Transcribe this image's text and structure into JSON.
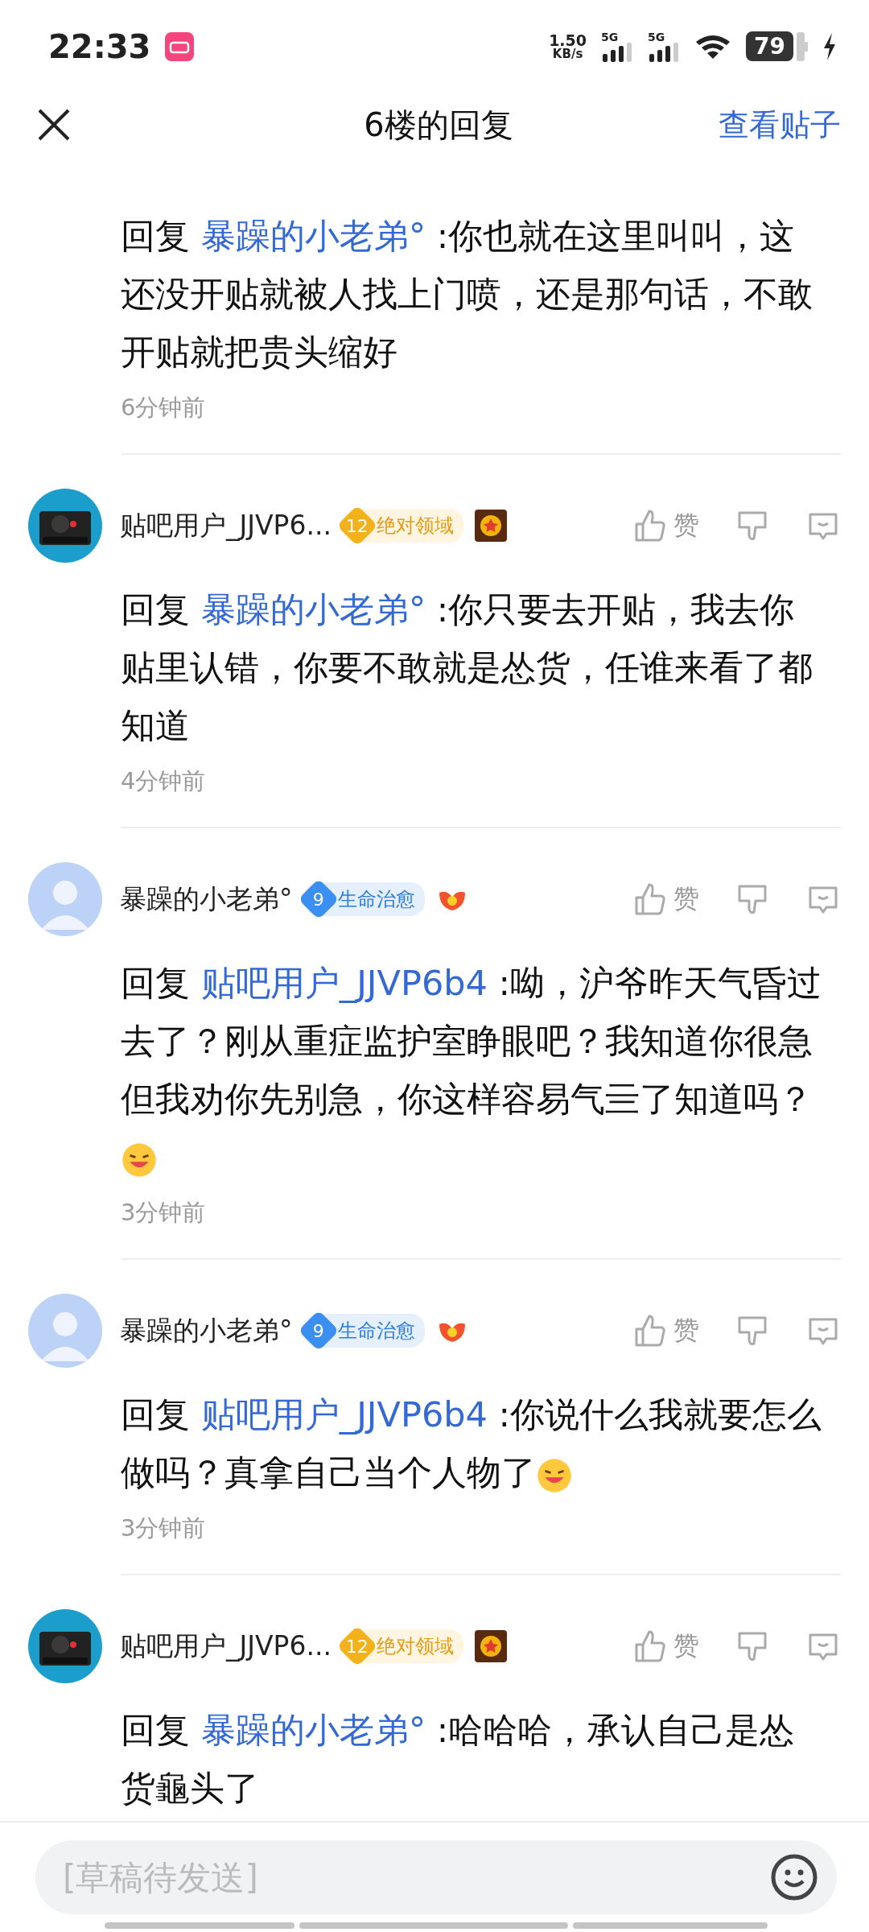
{
  "status_bar": {
    "time": "22:33",
    "speed_value": "1.50",
    "speed_unit": "KB/s",
    "networks": [
      "5G",
      "5G"
    ],
    "battery": "79"
  },
  "header": {
    "title": "6楼的回复",
    "action": "查看贴子"
  },
  "replies": [
    {
      "prefix": "回复",
      "target": "暴躁的小老弟°",
      "text": ":你也就在这里叫叫，这还没开贴就被人找上门喷，还是那句话，不敢开贴就把贵头缩好",
      "emoji": false,
      "time": "6分钟前"
    },
    {
      "user": {
        "kind": "camera",
        "name": "贴吧用户_JJVP6...",
        "badge": {
          "level": "12",
          "title": "绝对领域",
          "color": "#f3b21c"
        }
      },
      "like": "赞",
      "prefix": "回复",
      "target": "暴躁的小老弟°",
      "text": ":你只要去开贴，我去你贴里认错，你要不敢就是怂货，任谁来看了都知道",
      "emoji": false,
      "time": "4分钟前"
    },
    {
      "user": {
        "kind": "default",
        "name": "暴躁的小老弟°",
        "badge": {
          "level": "9",
          "title": "生命治愈",
          "color": "#3a8ff0"
        }
      },
      "like": "赞",
      "prefix": "回复",
      "target": "贴吧用户_JJVP6b4",
      "text": ":呦，沪爷昨天气昏过去了？刚从重症监护室睁眼吧？我知道你很急但我劝你先别急，你这样容易气亖了知道吗？",
      "emoji": true,
      "time": "3分钟前"
    },
    {
      "user": {
        "kind": "default",
        "name": "暴躁的小老弟°",
        "badge": {
          "level": "9",
          "title": "生命治愈",
          "color": "#3a8ff0"
        }
      },
      "like": "赞",
      "prefix": "回复",
      "target": "贴吧用户_JJVP6b4",
      "text": ":你说什么我就要怎么做吗？真拿自己当个人物了",
      "emoji": true,
      "time": "3分钟前"
    },
    {
      "user": {
        "kind": "camera",
        "name": "贴吧用户_JJVP6...",
        "badge": {
          "level": "12",
          "title": "绝对领域",
          "color": "#f3b21c"
        }
      },
      "like": "赞",
      "prefix": "回复",
      "target": "暴躁的小老弟°",
      "text": ":哈哈哈，承认自己是怂货龜头了",
      "emoji": false
    }
  ],
  "composer": {
    "placeholder": "[草稿待发送]"
  }
}
